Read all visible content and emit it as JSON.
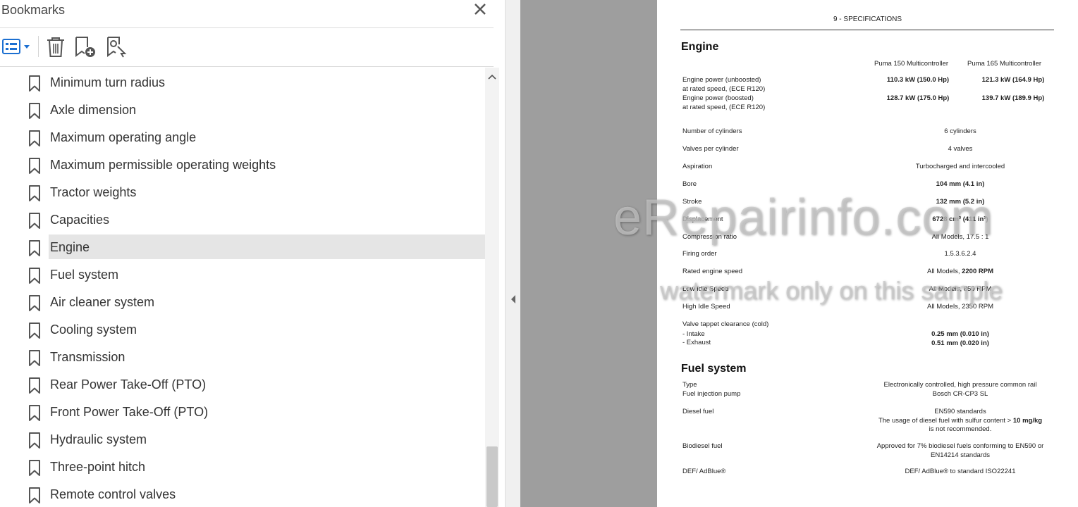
{
  "bookmarks_panel": {
    "title": "Bookmarks",
    "toolbar": {
      "options_icon": "list-options-icon",
      "delete_icon": "trash-icon",
      "new_bookmark_icon": "add-bookmark-icon",
      "find_bookmark_icon": "find-bookmark-icon"
    },
    "items": [
      {
        "label": "Minimum turn radius"
      },
      {
        "label": "Axle dimension"
      },
      {
        "label": "Maximum operating angle"
      },
      {
        "label": "Maximum permissible operating weights"
      },
      {
        "label": "Tractor weights"
      },
      {
        "label": "Capacities"
      },
      {
        "label": "Engine",
        "selected": true
      },
      {
        "label": "Fuel system"
      },
      {
        "label": "Air cleaner system"
      },
      {
        "label": "Cooling system"
      },
      {
        "label": "Transmission"
      },
      {
        "label": "Rear Power Take-Off (PTO)"
      },
      {
        "label": "Front Power Take-Off (PTO)"
      },
      {
        "label": "Hydraulic system"
      },
      {
        "label": "Three-point hitch"
      },
      {
        "label": "Remote control valves"
      }
    ],
    "selection_color": "#e5e5e5"
  },
  "document": {
    "header": "9 - SPECIFICATIONS",
    "engine": {
      "title": "Engine",
      "col1": "Puma 150 Multicontroller",
      "col2": "Puma 165 Multicontroller",
      "power_unboosted": {
        "label1": "Engine power (unboosted)",
        "label2": "at rated speed, (ECE R120)",
        "v1": "110.3 kW (150.0 Hp)",
        "v2": "121.3 kW (164.9 Hp)"
      },
      "power_boosted": {
        "label1": "Engine power (boosted)",
        "label2": "at rated speed, (ECE R120)",
        "v1": "128.7 kW (175.0 Hp)",
        "v2": "139.7 kW (189.9 Hp)"
      },
      "cylinders": {
        "label": "Number of cylinders",
        "value": "6 cylinders"
      },
      "valves": {
        "label": "Valves per cylinder",
        "value": "4 valves"
      },
      "aspiration": {
        "label": "Aspiration",
        "value": "Turbocharged and intercooled"
      },
      "bore": {
        "label": "Bore",
        "value": "104 mm (4.1 in)"
      },
      "stroke": {
        "label": "Stroke",
        "value": "132 mm (5.2 in)"
      },
      "displacement": {
        "label": "Displacement",
        "value": "6728 cm³ (411 in³)"
      },
      "compression": {
        "label": "Compression ratio",
        "value": "All Models, 17.5 : 1"
      },
      "firing": {
        "label": "Firing order",
        "value": "1.5.3.6.2.4"
      },
      "rated_speed": {
        "label": "Rated engine speed",
        "prefix": "All Models, ",
        "value": "2200 RPM"
      },
      "low_idle": {
        "label": "Low Idle Speed",
        "value": "All Models, 850 RPM"
      },
      "high_idle": {
        "label": "High Idle Speed",
        "value": "All Models, 2350 RPM"
      },
      "tappet": {
        "label": "Valve tappet clearance (cold)",
        "intake_label": "- Intake",
        "exhaust_label": "- Exhaust",
        "intake": "0.25 mm (0.010 in)",
        "exhaust": "0.51 mm (0.020 in)"
      }
    },
    "fuel": {
      "title": "Fuel system",
      "type": {
        "label": "Type",
        "value": "Electronically controlled, high pressure common rail"
      },
      "pump": {
        "label": "Fuel injection pump",
        "value": "Bosch CR-CP3 SL"
      },
      "diesel": {
        "label": "Diesel fuel",
        "line1": "EN590 standards",
        "line2a": "The usage of diesel fuel with sulfur content > ",
        "line2b": "10 mg/kg",
        "line3": "is not recommended."
      },
      "biodiesel": {
        "label": "Biodiesel fuel",
        "line1": "Approved for 7% biodiesel fuels conforming to EN590 or",
        "line2": "EN14214 standards"
      },
      "def": {
        "label": "DEF/ AdBlue®",
        "value": "DEF/ AdBlue® to standard ISO22241"
      }
    }
  },
  "watermark": {
    "line1": "eRepairinfo.com",
    "line2": "watermark only on this sample"
  }
}
